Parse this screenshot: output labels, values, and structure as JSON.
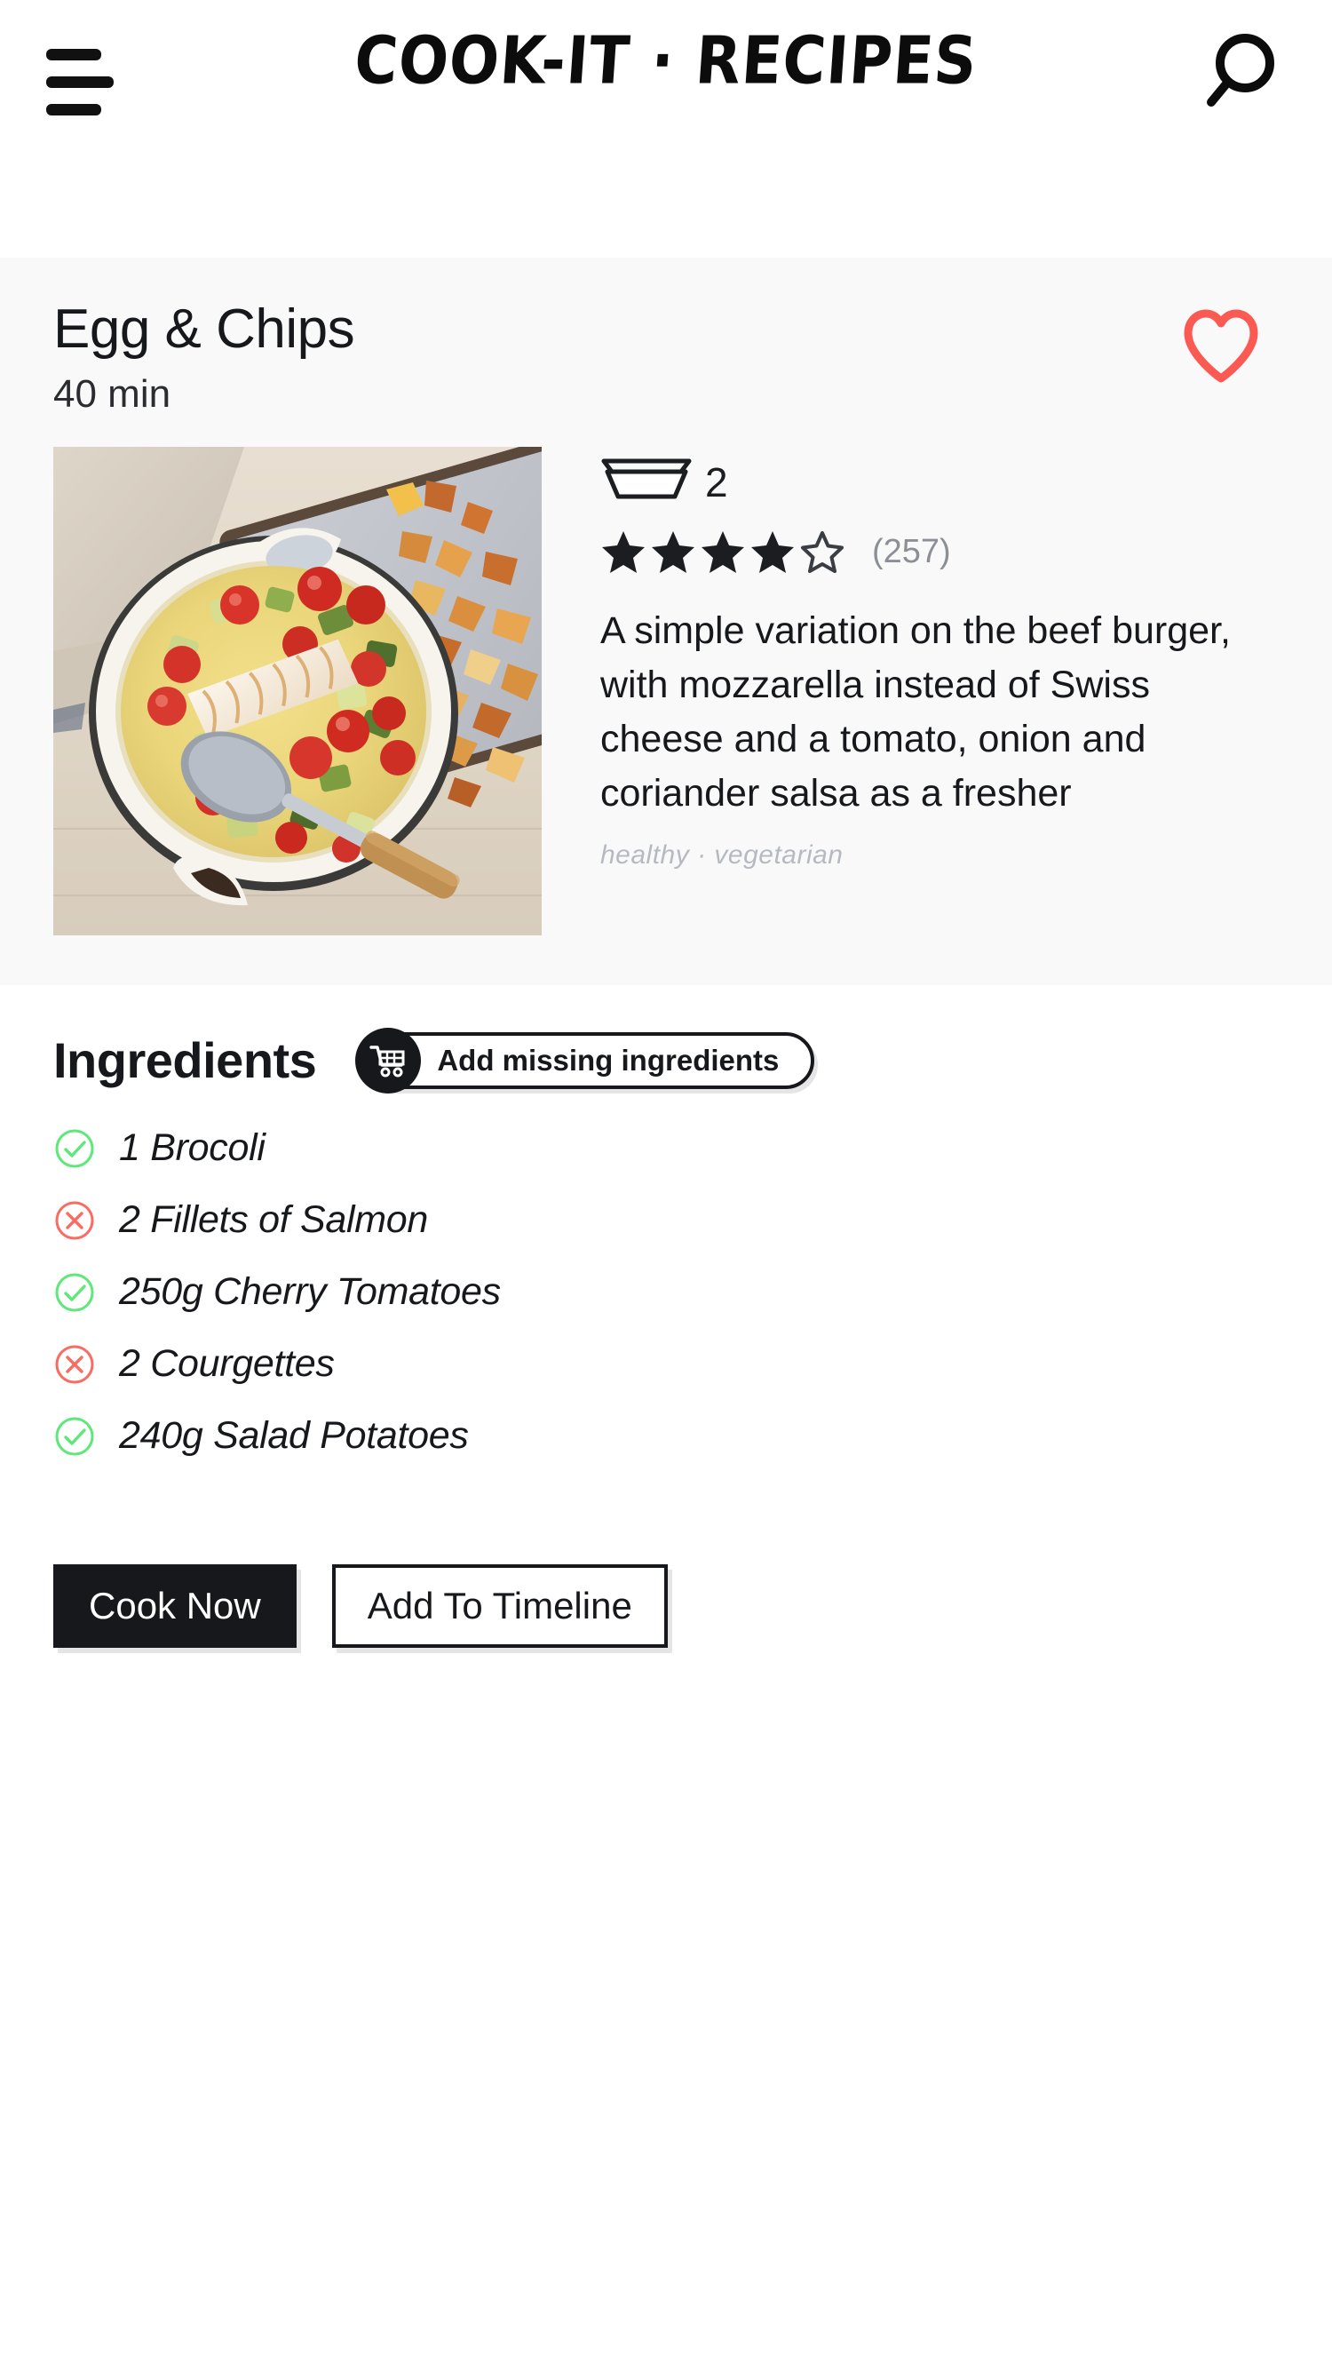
{
  "header": {
    "menu_icon": "hamburger-menu-icon",
    "title": "COOK-IT · RECIPES",
    "search_icon": "search-icon"
  },
  "recipe": {
    "title": "Egg & Chips",
    "time": "40 min",
    "favorite_icon": "heart-outline-icon",
    "favorite_color": "#FB5A52",
    "servings_icon": "stacked-plates-icon",
    "servings": "2",
    "rating": 4,
    "rating_max": 5,
    "review_count": "(257)",
    "description": "A simple variation on the beef burger, with mozzarella instead of Swiss cheese and a tomato, onion and coriander salsa as a fresher",
    "tags": "healthy · vegetarian",
    "photo_alt": "skillet of creamy vegetable curry with salmon fillet beside roast potatoes"
  },
  "ingredients": {
    "heading": "Ingredients",
    "add_missing_label": "Add missing ingredients",
    "cart_icon": "shopping-cart-icon",
    "available_color": "#5EE87A",
    "missing_color": "#FB6B63",
    "items": [
      {
        "label": "1 Brocoli",
        "status": "available",
        "icon": "check-circle-icon"
      },
      {
        "label": "2 Fillets of Salmon",
        "status": "missing",
        "icon": "x-circle-icon"
      },
      {
        "label": "250g Cherry Tomatoes",
        "status": "available",
        "icon": "check-circle-icon"
      },
      {
        "label": "2 Courgettes",
        "status": "missing",
        "icon": "x-circle-icon"
      },
      {
        "label": "240g Salad Potatoes",
        "status": "available",
        "icon": "check-circle-icon"
      }
    ]
  },
  "actions": {
    "cook_now": "Cook Now",
    "add_to_timeline": "Add To Timeline"
  }
}
